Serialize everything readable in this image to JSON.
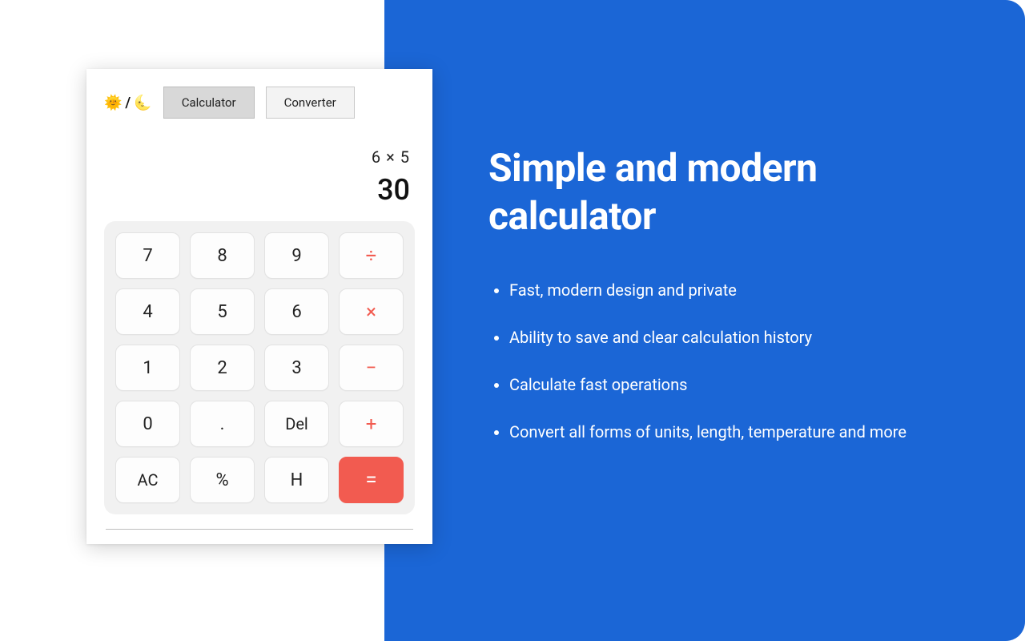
{
  "theme_toggle": {
    "sun": "🌞",
    "slash": "/",
    "moon": "🌜"
  },
  "tabs": {
    "calculator": "Calculator",
    "converter": "Converter"
  },
  "display": {
    "expression": "6 × 5",
    "result": "30"
  },
  "keys": {
    "r0c0": "7",
    "r0c1": "8",
    "r0c2": "9",
    "r0c3": "÷",
    "r1c0": "4",
    "r1c1": "5",
    "r1c2": "6",
    "r1c3": "×",
    "r2c0": "1",
    "r2c1": "2",
    "r2c2": "3",
    "r2c3": "−",
    "r3c0": "0",
    "r3c1": ".",
    "r3c2": "Del",
    "r3c3": "+",
    "r4c0": "AC",
    "r4c1": "%",
    "r4c2": "H",
    "r4c3": "="
  },
  "promo": {
    "title": "Simple and modern calculator",
    "bullets": {
      "b1": "Fast, modern design and private",
      "b2": "Ability to save and clear calculation history",
      "b3": "Calculate fast operations",
      "b4": "Convert all forms of units, length, temperature and more"
    }
  }
}
